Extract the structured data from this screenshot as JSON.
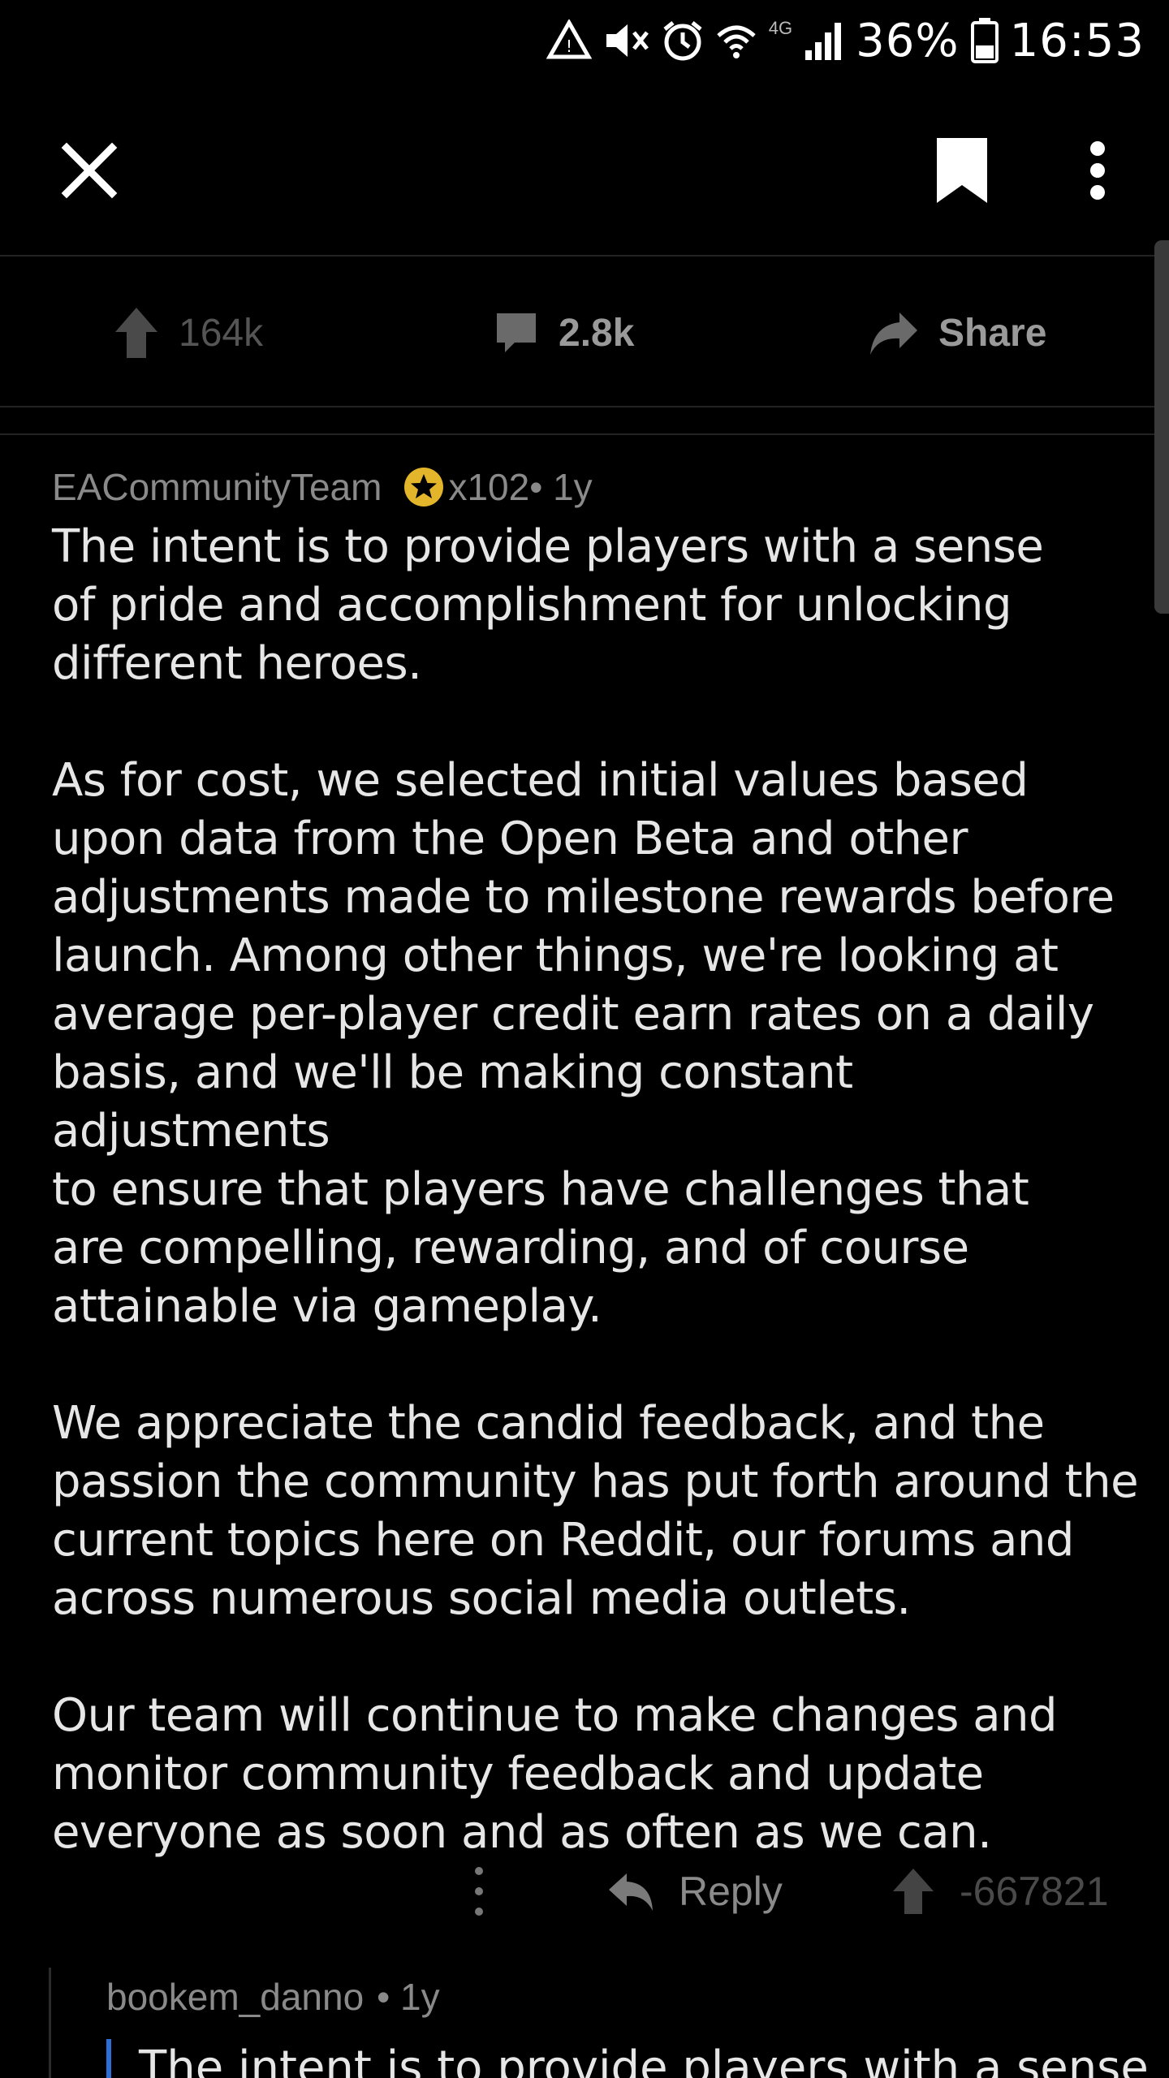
{
  "status_bar": {
    "icons": [
      "recycle-alert-icon",
      "mute-icon",
      "alarm-icon",
      "wifi-icon",
      "lte-icon",
      "signal-icon",
      "battery-icon"
    ],
    "lte_label": "4G",
    "battery": "36%",
    "time": "16:53"
  },
  "toolbar": {
    "close_icon": "close-icon",
    "bookmark_icon": "bookmark-icon",
    "more_icon": "more-vertical-icon"
  },
  "actions": {
    "upvotes": "164k",
    "comments": "2.8k",
    "share": "Share"
  },
  "comment": {
    "author": "EACommunityTeam",
    "award_count": "x102",
    "age": "• 1y",
    "paragraphs": [
      "The intent is to provide players with a sense\nof pride and accomplishment for unlocking\ndifferent heroes.",
      "As for cost, we selected initial values based\nupon data from the Open Beta and other\nadjustments made to milestone rewards before\nlaunch.  Among other things, we're looking at\naverage per-player credit earn rates on a daily\nbasis, and we'll be making constant adjustments\nto ensure that players have challenges that\nare compelling, rewarding, and of course\nattainable via gameplay.",
      "We appreciate the candid feedback, and the\npassion the community has put forth around the\ncurrent topics here on Reddit, our forums and\nacross numerous social media outlets.",
      "Our team will continue to make changes and\nmonitor community feedback and update\neveryone as soon and as often as we can."
    ],
    "reply_label": "Reply",
    "score": "-667821"
  },
  "reply": {
    "author": "bookem_danno",
    "age": "• 1y",
    "quote": "The intent is to provide players with a sense"
  },
  "colors": {
    "background": "#000000",
    "text": "#e6e6e6",
    "muted": "#8a8a8a",
    "award_gold": "#e3b52a",
    "quote_bar": "#2d6fd8"
  }
}
